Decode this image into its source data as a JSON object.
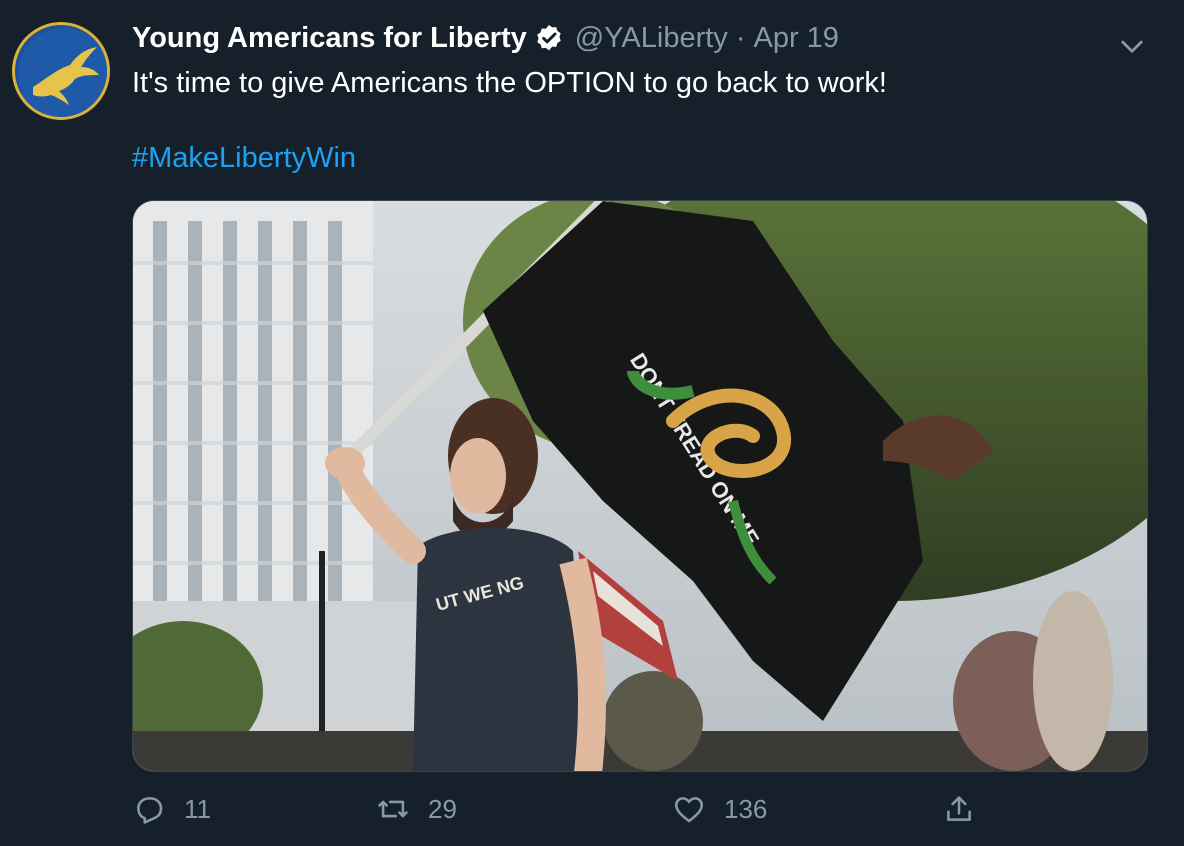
{
  "tweet": {
    "display_name": "Young Americans for Liberty",
    "handle": "@YALiberty",
    "separator": "·",
    "date": "Apr 19",
    "text": "It's time to give Americans the OPTION to go back to work!",
    "hashtag": "#MakeLibertyWin",
    "verified": true
  },
  "media": {
    "flag_text": "DONT TREAD ON ME",
    "shirt_text": "UT WE NG"
  },
  "actions": {
    "reply_count": "11",
    "retweet_count": "29",
    "like_count": "136"
  },
  "icons": {
    "reply": "reply-icon",
    "retweet": "retweet-icon",
    "like": "heart-icon",
    "share": "share-icon",
    "more": "chevron-down-icon",
    "verified": "verified-badge-icon"
  },
  "colors": {
    "background": "#15202b",
    "muted": "#8899a6",
    "link": "#1da1f2",
    "verified_badge": "#ffffff"
  }
}
